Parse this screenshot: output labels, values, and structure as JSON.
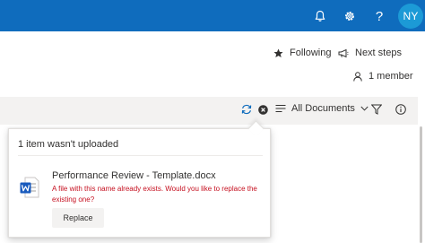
{
  "header": {
    "avatar_initials": "NY",
    "help_label": "?",
    "icons": [
      "bell-icon",
      "gear-icon",
      "help-icon"
    ],
    "background": "#0f6cbd"
  },
  "actions": {
    "following_label": "Following",
    "next_steps_label": "Next steps",
    "members_label": "1 member"
  },
  "command_bar": {
    "view_label": "All Documents",
    "icons": [
      "sync-icon",
      "upload-error-icon",
      "view-list-icon",
      "chevron-down-icon",
      "filter-icon",
      "info-icon"
    ]
  },
  "upload_callout": {
    "title": "1 item wasn't uploaded",
    "file_name": "Performance Review - Template.docx",
    "file_icon": "word-document-icon",
    "error_message": "A file with this name already exists. Would you like to replace the existing one?",
    "replace_label": "Replace",
    "error_color": "#c50f1f"
  }
}
